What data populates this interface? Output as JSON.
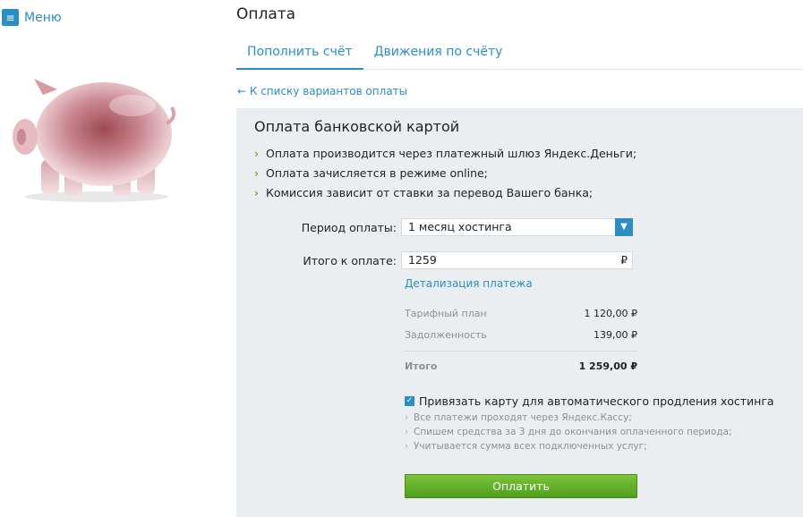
{
  "sidebar": {
    "menu_icon": "≡",
    "menu_label": "Меню"
  },
  "header": {
    "title": "Оплата"
  },
  "tabs": [
    {
      "label": "Пополнить счёт",
      "active": true
    },
    {
      "label": "Движения по счёту",
      "active": false
    }
  ],
  "back_link": "← К списку вариантов оплаты",
  "panel": {
    "title": "Оплата банковской картой",
    "bullets": [
      "Оплата производится через платежный шлюз Яндекс.Деньги;",
      "Оплата зачисляется в режиме online;",
      "Комиссия зависит от ставки за перевод Вашего банка;"
    ],
    "period_label": "Период оплаты:",
    "period_value": "1 месяц хостинга",
    "total_label": "Итого к оплате:",
    "total_value": "1259",
    "currency": "₽",
    "detail_link": "Детализация платежа",
    "breakdown": [
      {
        "label": "Тарифный план",
        "value": "1 120,00 ₽"
      },
      {
        "label": "Задолженность",
        "value": "139,00 ₽"
      }
    ],
    "breakdown_total": {
      "label": "Итого",
      "value": "1 259,00 ₽"
    },
    "autorenew_checked": true,
    "autorenew_label": "Привязать карту для автоматического продления хостинга",
    "notes": [
      "Все платежи проходят через Яндекс.Кассу;",
      "Спишем средства за 3 дня до окончания оплаченного периода;",
      "Учитывается сумма всех подключенных услуг;"
    ],
    "pay_button": "Оплатить"
  },
  "colors": {
    "accent": "#2a8fc7",
    "bullet_chevron": "#6cab2e",
    "panel_bg": "#ebeef1",
    "pay_button": "#5aac27"
  }
}
